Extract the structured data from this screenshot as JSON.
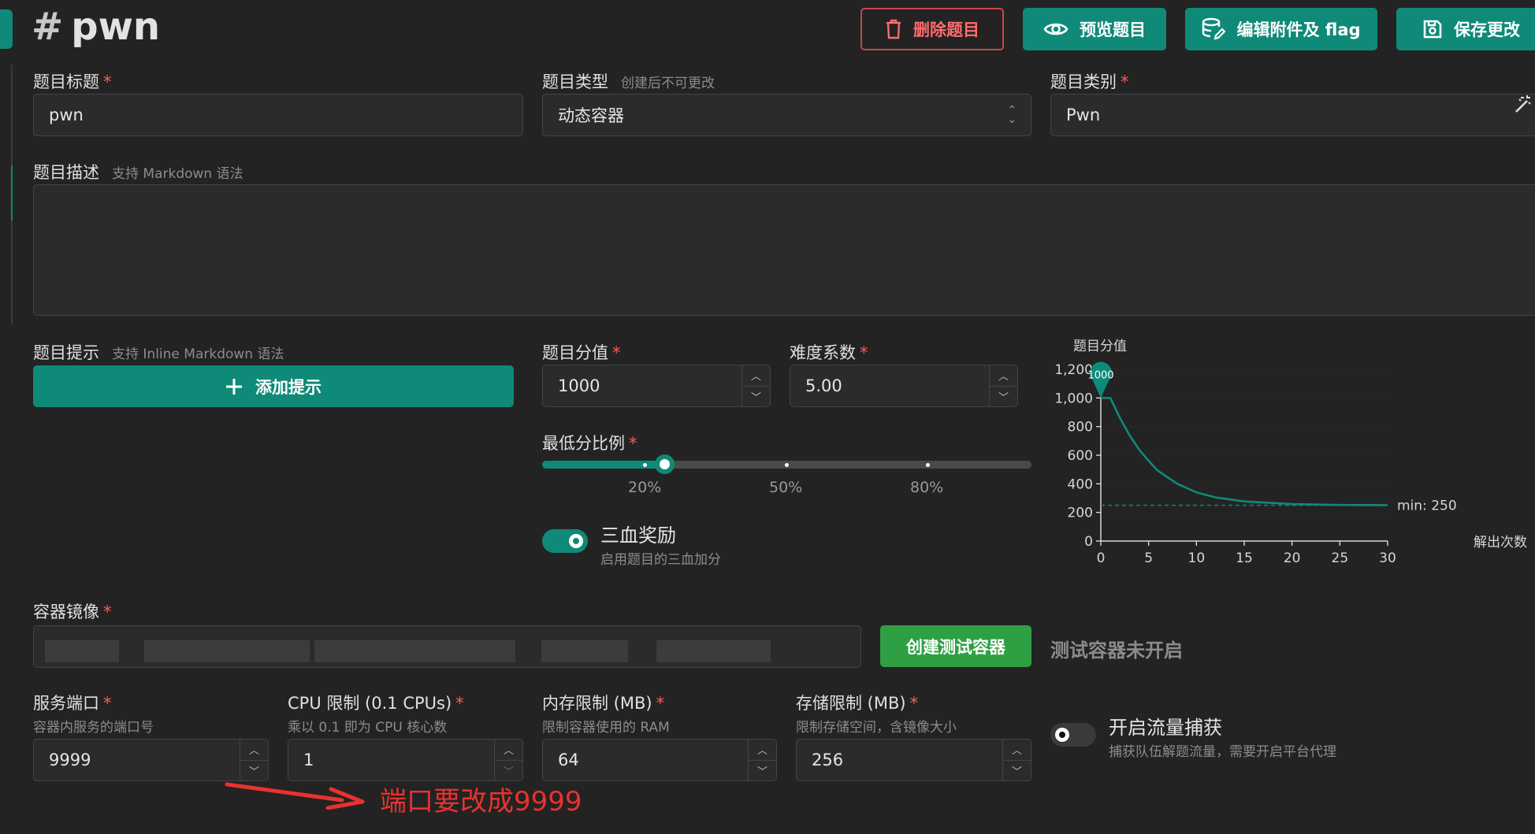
{
  "header": {
    "hash": "#",
    "title": "pwn",
    "buttons": {
      "delete": "删除题目",
      "preview": "预览题目",
      "attachments": "编辑附件及 flag",
      "save": "保存更改"
    }
  },
  "fields": {
    "title": {
      "label": "题目标题",
      "value": "pwn"
    },
    "type": {
      "label": "题目类型",
      "hint": "创建后不可更改",
      "value": "动态容器"
    },
    "category": {
      "label": "题目类别",
      "value": "Pwn"
    },
    "description": {
      "label": "题目描述",
      "hint": "支持 Markdown 语法"
    },
    "hints": {
      "label": "题目提示",
      "hint": "支持 Inline Markdown 语法",
      "add_button": "添加提示"
    },
    "score": {
      "label": "题目分值",
      "value": "1000"
    },
    "difficulty": {
      "label": "难度系数",
      "value": "5.00"
    },
    "min_ratio": {
      "label": "最低分比例",
      "value": 0.25,
      "marks": [
        "20%",
        "50%",
        "80%"
      ]
    },
    "blood_bonus": {
      "title": "三血奖励",
      "sub": "启用题目的三血加分",
      "enabled": true
    },
    "image": {
      "label": "容器镜像",
      "create_test": "创建测试容器",
      "test_status": "测试容器未开启"
    },
    "port": {
      "label": "服务端口",
      "sub": "容器内服务的端口号",
      "value": "9999"
    },
    "cpu": {
      "label": "CPU 限制 (0.1 CPUs)",
      "sub": "乘以 0.1 即为 CPU 核心数",
      "value": "1"
    },
    "memory": {
      "label": "内存限制 (MB)",
      "sub": "限制容器使用的 RAM",
      "value": "64"
    },
    "storage": {
      "label": "存储限制 (MB)",
      "sub": "限制存储空间，含镜像大小",
      "value": "256"
    },
    "traffic": {
      "title": "开启流量捕获",
      "sub": "捕获队伍解题流量，需要开启平台代理",
      "enabled": false
    }
  },
  "annotation": "端口要改成9999",
  "chart_data": {
    "type": "line",
    "title": "题目分值",
    "xlabel": "解出次数",
    "ylabel": "",
    "xlim": [
      0,
      30
    ],
    "ylim": [
      0,
      1200
    ],
    "xticks": [
      0,
      5,
      10,
      15,
      20,
      25,
      30
    ],
    "yticks": [
      "0",
      "200",
      "400",
      "600",
      "800",
      "1,000",
      "1,200"
    ],
    "marker_label": "1000",
    "min_label": "min: 250",
    "min_value": 250,
    "series": [
      {
        "x": [
          0,
          1,
          2,
          3,
          4,
          5,
          6,
          8,
          10,
          12,
          15,
          20,
          25,
          30
        ],
        "values": [
          1000,
          1000,
          860,
          740,
          640,
          560,
          490,
          400,
          340,
          305,
          277,
          258,
          252,
          251
        ]
      }
    ]
  },
  "colors": {
    "accent": "#0f8a78",
    "danger": "#e8322f",
    "success": "#2ea043"
  }
}
